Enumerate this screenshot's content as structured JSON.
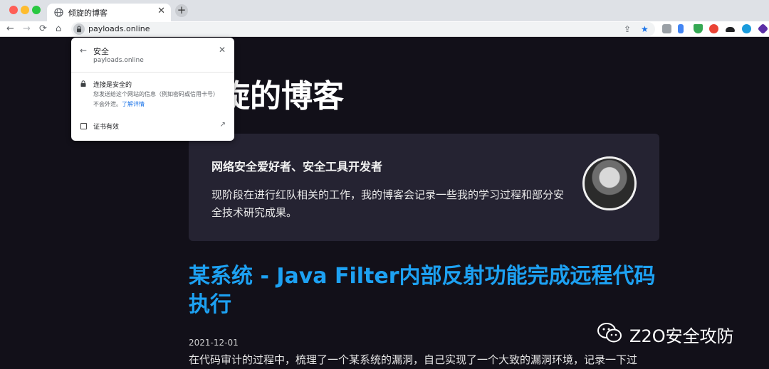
{
  "browser": {
    "tab": {
      "title": "倾旋的博客",
      "close": "✕"
    },
    "new_tab": "+",
    "nav": {
      "back": "←",
      "forward": "→",
      "reload": "⟳",
      "home": "⌂"
    },
    "url": "payloads.online",
    "share": "⇪",
    "bookmark": "★"
  },
  "security_popup": {
    "back": "←",
    "title": "安全",
    "domain": "payloads.online",
    "close": "✕",
    "connection_label": "连接是安全的",
    "connection_desc": "您发送给这个网站的信息（例如密码或信用卡号）不会外泄。",
    "learn_more": "了解详情",
    "certificate_label": "证书有效",
    "external": "↗"
  },
  "page": {
    "site_title": "倾旋的博客",
    "profile": {
      "name": "网络安全爱好者、安全工具开发者",
      "bio": "现阶段在进行红队相关的工作，我的博客会记录一些我的学习过程和部分安全技术研究成果。"
    },
    "post": {
      "title": "某系统 - Java Filter内部反射功能完成远程代码执行",
      "date": "2021-12-01",
      "excerpt": "在代码审计的过程中，梳理了一个某系统的漏洞，自己实现了一个大致的漏洞环境，记录一下过"
    },
    "watermark": "Z2O安全攻防"
  },
  "colors": {
    "page_bg": "#121019",
    "card_bg": "#252332",
    "post_title": "#1da1f2",
    "link": "#1a73e8"
  }
}
